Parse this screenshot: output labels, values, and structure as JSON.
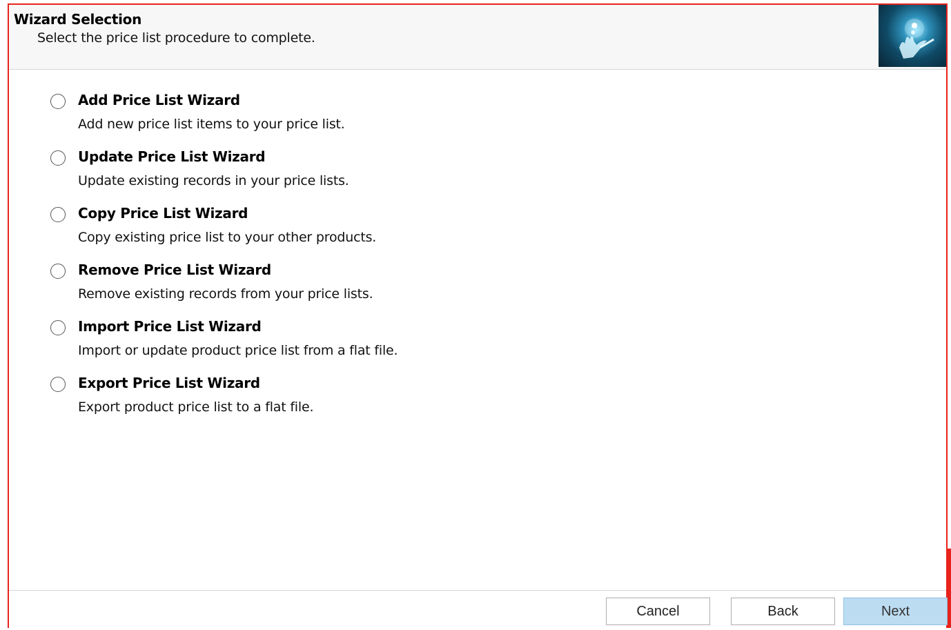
{
  "header": {
    "title": "Wizard Selection",
    "subtitle": "Select the price list procedure to complete.",
    "image_icon": "hand-light-icon"
  },
  "options": [
    {
      "title": "Add Price List Wizard",
      "description": "Add new price list items to your price list.",
      "selected": false
    },
    {
      "title": "Update Price List Wizard",
      "description": "Update existing records in your price lists.",
      "selected": false
    },
    {
      "title": "Copy Price List Wizard",
      "description": "Copy existing price list to your other products.",
      "selected": false
    },
    {
      "title": "Remove Price List Wizard",
      "description": "Remove existing records from your price lists.",
      "selected": false
    },
    {
      "title": "Import Price List Wizard",
      "description": "Import or update product price list from a flat file.",
      "selected": false
    },
    {
      "title": "Export Price List Wizard",
      "description": "Export product price list to a flat file.",
      "selected": false
    }
  ],
  "footer": {
    "cancel_label": "Cancel",
    "back_label": "Back",
    "next_label": "Next"
  },
  "colors": {
    "border_accent": "#e8231b",
    "next_button_bg": "#bcdcf2"
  }
}
